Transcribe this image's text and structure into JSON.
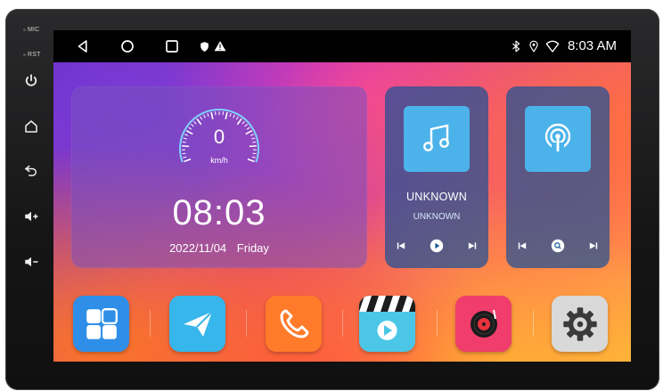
{
  "device": {
    "labels": {
      "mic": "MIC",
      "rst": "RST"
    },
    "side_buttons": [
      "power-icon",
      "home-icon",
      "back-icon",
      "volume-up-icon",
      "volume-down-icon"
    ]
  },
  "status_bar": {
    "nav": [
      "back-icon",
      "home-icon",
      "recents-icon"
    ],
    "notifications": [
      "shield-icon",
      "warning-icon"
    ],
    "indicators": [
      "bluetooth-icon",
      "location-icon",
      "wifi-icon"
    ],
    "time": "8:03 AM"
  },
  "speed_widget": {
    "speed": "0",
    "unit": "km/h",
    "time": "08:03",
    "date": "2022/11/04",
    "weekday": "Friday"
  },
  "music_card": {
    "icon": "music-note-icon",
    "title": "UNKNOWN",
    "artist": "UNKNOWN",
    "controls": [
      "previous-icon",
      "play-icon",
      "next-icon"
    ]
  },
  "radio_card": {
    "icon": "radio-broadcast-icon",
    "controls": [
      "previous-icon",
      "search-icon",
      "next-icon"
    ]
  },
  "dock": {
    "apps": [
      {
        "name": "app-drawer",
        "icon": "grid-icon",
        "color": "#2f8fe8"
      },
      {
        "name": "navigation",
        "icon": "paper-plane-icon",
        "color": "#36b6ea"
      },
      {
        "name": "phone",
        "icon": "phone-icon",
        "color": "#ff7b2a"
      },
      {
        "name": "video",
        "icon": "clapperboard-icon",
        "color": "#4cc6e6"
      },
      {
        "name": "music",
        "icon": "vinyl-icon",
        "color": "#f03d6b"
      },
      {
        "name": "settings",
        "icon": "gear-icon",
        "color": "#d9d9d9"
      }
    ]
  }
}
